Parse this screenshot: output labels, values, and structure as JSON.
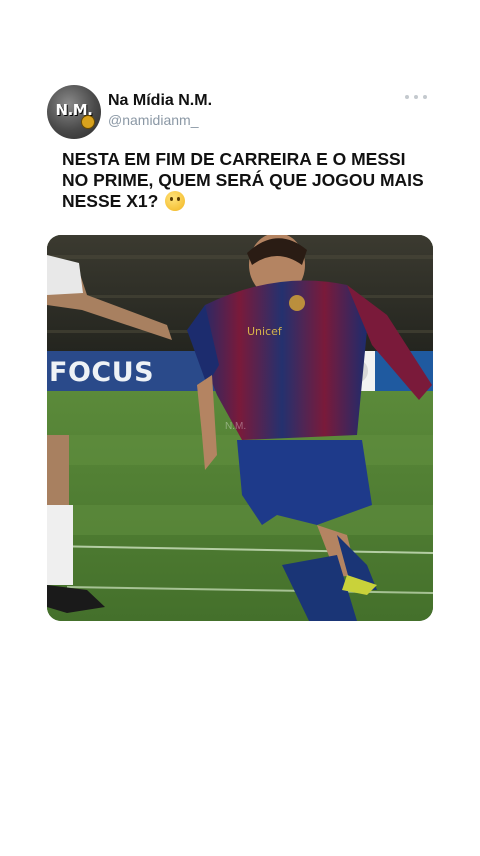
{
  "post": {
    "author_name": "Na Mídia N.M.",
    "author_handle": "@namidianm_",
    "avatar_text": "N.M.",
    "text": "NESTA EM FIM DE CARREIRA E O MESSI NO PRIME, QUEM SERÁ QUE JOGOU MAIS NESSE X1?",
    "emoji": "thinking-face-emoji"
  },
  "media": {
    "banner_text": "FOCUS",
    "watermark": "N.M.",
    "colors": {
      "pitch": "#4f7d33",
      "stands": "#2c2a24",
      "shirt_blue": "#1c2c6e",
      "shirt_red": "#7a1a3a",
      "shorts": "#1e3a8a",
      "socks": "#1a3576"
    }
  },
  "icons": {
    "more": "more-horizontal-icon"
  }
}
